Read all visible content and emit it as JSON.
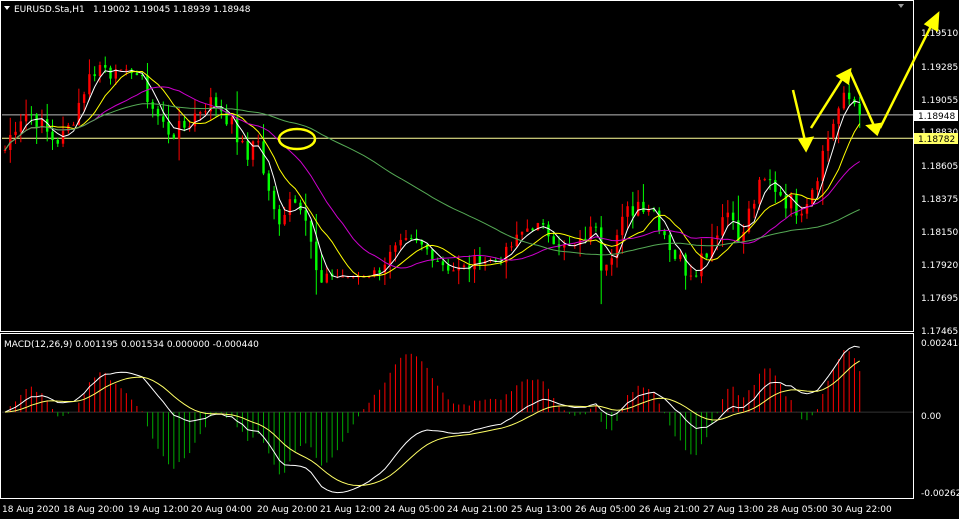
{
  "window": {
    "title": "EURUSD.Sta,H1",
    "ohlc": "1.19002 1.19045 1.18939 1.18948"
  },
  "colors": {
    "background": "#000000",
    "frame": "#ffffff",
    "bull": "#ff0000",
    "bear": "#00ff00",
    "ma_fast": "#ffffff",
    "ma_mid": "#ffff00",
    "ma_slow": "#cc00cc",
    "ma_long": "#55aa55",
    "annotation": "#ffff00",
    "macd_line": "#ffffff",
    "signal_line": "#ffff66",
    "hist_pos": "#ff0000",
    "hist_neg": "#00aa00",
    "price_label_bg": "#ffffff",
    "price_label_text": "#000000"
  },
  "chart_data": [
    {
      "type": "candlestick",
      "title": "EURUSD.Sta,H1",
      "y_ticks": [
        "1.19510",
        "1.19285",
        "1.19055",
        "1.18830",
        "1.18605",
        "1.18375",
        "1.18150",
        "1.17920",
        "1.17695",
        "1.17465"
      ],
      "ylim": [
        1.1742,
        1.1975
      ],
      "grid": false,
      "x_ticks": [
        "18 Aug 2020",
        "18 Aug 20:00",
        "19 Aug 12:00",
        "20 Aug 04:00",
        "20 Aug 20:00",
        "21 Aug 12:00",
        "24 Aug 05:00",
        "24 Aug 21:00",
        "25 Aug 13:00",
        "26 Aug 05:00",
        "26 Aug 21:00",
        "27 Aug 13:00",
        "28 Aug 05:00",
        "30 Aug 22:00"
      ],
      "price_labels": [
        {
          "text": "1.18948",
          "value": 1.18948,
          "style": "white-box"
        },
        {
          "text": "1.18782",
          "value": 1.18782,
          "style": "yellow-box"
        }
      ],
      "series_overview": [
        {
          "segment": "18 Aug 2020 - 19 Aug 12:00",
          "open": 1.187,
          "high": 1.1963,
          "low": 1.1866,
          "close": 1.192
        },
        {
          "segment": "19 Aug 12:00 - 20 Aug 20:00",
          "open": 1.192,
          "high": 1.1927,
          "low": 1.1826,
          "close": 1.1872
        },
        {
          "segment": "20 Aug 20:00 - 21 Aug 12:00",
          "open": 1.1872,
          "high": 1.1876,
          "low": 1.1756,
          "close": 1.1782
        },
        {
          "segment": "21 Aug 12:00 - 24 Aug 21:00",
          "open": 1.1782,
          "high": 1.185,
          "low": 1.178,
          "close": 1.18
        },
        {
          "segment": "24 Aug 21:00 - 26 Aug 05:00",
          "open": 1.18,
          "high": 1.1845,
          "low": 1.1787,
          "close": 1.1814
        },
        {
          "segment": "26 Aug 05:00 - 27 Aug 13:00",
          "open": 1.1814,
          "high": 1.1893,
          "low": 1.1765,
          "close": 1.1806
        },
        {
          "segment": "27 Aug 13:00 - 30 Aug 22:00",
          "open": 1.1806,
          "high": 1.1918,
          "low": 1.18,
          "close": 1.18948
        }
      ],
      "hline_values": [
        1.18948,
        1.18782
      ]
    },
    {
      "type": "macd",
      "label": "MACD(12,26,9) 0.001195 0.001534 0.000000 -0.000440",
      "y_ticks": [
        "0.002418",
        "0.00",
        "-0.002628"
      ],
      "ylim": [
        -0.0029,
        0.0026
      ]
    }
  ]
}
